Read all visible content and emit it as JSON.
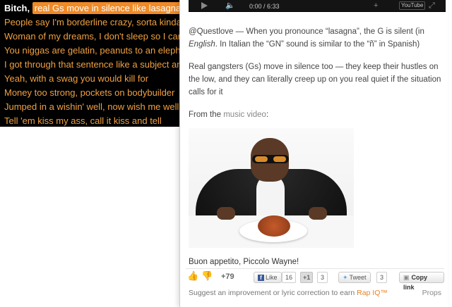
{
  "lyrics": {
    "line1_lead": "Bitch,",
    "line1_highlight": "real Gs move in silence like lasagna",
    "lines": [
      "People say I'm borderline crazy, sorta kinda",
      "Woman of my dreams, I don't sleep so I can't find her",
      "You niggas are gelatin, peanuts to an elephant",
      "I got through that sentence like a subject and predicate",
      "Yeah, with a swag you would kill for",
      "Money too strong, pockets on bodybuilder",
      "Jumped in a wishin' well, now wish me well",
      "Tell 'em kiss my ass, call it kiss and tell"
    ]
  },
  "player": {
    "time": "0:00 / 6:33",
    "play_icon": "play-icon",
    "volume_icon": "volume-icon",
    "plus_icon": "plus-icon",
    "youtube_label": "YouTube",
    "fullscreen_icon": "fullscreen-icon"
  },
  "annotation": {
    "para1_a": "@Questlove — When you pronounce “lasagna”, the G is silent (in ",
    "para1_em": "English",
    "para1_b": ". In Italian the “GN” sound is similar to the “ñ” in Spanish)",
    "para2": "Real gangsters (Gs) move in silence too — they keep their hustles on the low, and they can literally creep up on you real quiet if the situation calls for it",
    "para3_a": "From the ",
    "para3_link": "music video",
    "para3_b": ":",
    "signoff": "Buon appetito, Piccolo Wayne!"
  },
  "actions": {
    "thumbs_up_icon": "thumbs-up-icon",
    "thumbs_down_icon": "thumbs-down-icon",
    "score": "+79",
    "like_label": "Like",
    "like_count": "16",
    "gplus_label": "+1",
    "gplus_count": "3",
    "tweet_label": "Tweet",
    "tweet_count": "3",
    "copy_label": "Copy link"
  },
  "footer": {
    "text": "Suggest an improvement or lyric correction to earn ",
    "link": "Rap IQ™",
    "props": "Props"
  },
  "colors": {
    "lyric_orange": "#f0a040",
    "highlight": "#f08a26",
    "rap_iq": "#e8842a"
  }
}
